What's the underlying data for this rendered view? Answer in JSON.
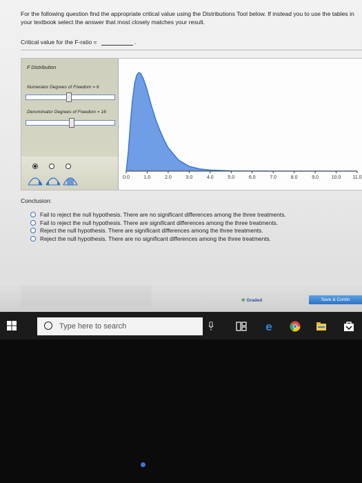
{
  "question": {
    "instructions": "For the following question find the appropriate critical value using the Distributions Tool below. If instead you to use the tables in your textbook select the answer that most closely matches your result.",
    "critical_value_label": "Critical value for the F-ratio =",
    "critical_value_suffix": "."
  },
  "distribution_tool": {
    "title": "F Distribution",
    "numerator_label": "Numerator Degrees of Freedom = 6",
    "numerator_df": 6,
    "denominator_label": "Denominator Degrees of Freedom = 16",
    "denominator_df": 16,
    "selected_tail_option": 0,
    "curve_color": "#2f6fd6",
    "fill_color": "#6f9de6"
  },
  "chart_data": {
    "type": "area",
    "title": "",
    "xlabel": "",
    "ylabel": "",
    "x_ticks": [
      "0.0",
      "1.0",
      "2.0",
      "3.0",
      "4.0",
      "5.0",
      "6.0",
      "7.0",
      "8.0",
      "9.0",
      "10.0",
      "11.0"
    ],
    "xlim": [
      0,
      11
    ],
    "series": [
      {
        "x": [
          0.0,
          0.1,
          0.2,
          0.3,
          0.4,
          0.5,
          0.6,
          0.7,
          0.8,
          0.9,
          1.0,
          1.2,
          1.4,
          1.6,
          1.8,
          2.0,
          2.5,
          3.0,
          3.5,
          4.0,
          5.0,
          6.0,
          7.0,
          8.0,
          9.0,
          10.0,
          11.0
        ],
        "y": [
          0.0,
          0.14,
          0.35,
          0.52,
          0.64,
          0.7,
          0.72,
          0.71,
          0.68,
          0.64,
          0.59,
          0.48,
          0.38,
          0.3,
          0.23,
          0.17,
          0.08,
          0.035,
          0.016,
          0.008,
          0.002,
          0.0006,
          0.0002,
          0.0,
          0.0,
          0.0,
          0.0
        ]
      }
    ]
  },
  "conclusion": {
    "title": "Conclusion:",
    "options": [
      "Fail to reject the null hypothesis. There are no significant differences among the three treatments.",
      "Fail to reject the null hypothesis. There are significant differences among the three treatments.",
      "Reject the null hypothesis. There are significant differences among the three treatments.",
      "Reject the null hypothesis. There are no significant differences among the three treatments."
    ]
  },
  "footer": {
    "graded_label": "Graded",
    "save_button": "Save & Contin"
  },
  "taskbar": {
    "search_placeholder": "Type here to search"
  }
}
